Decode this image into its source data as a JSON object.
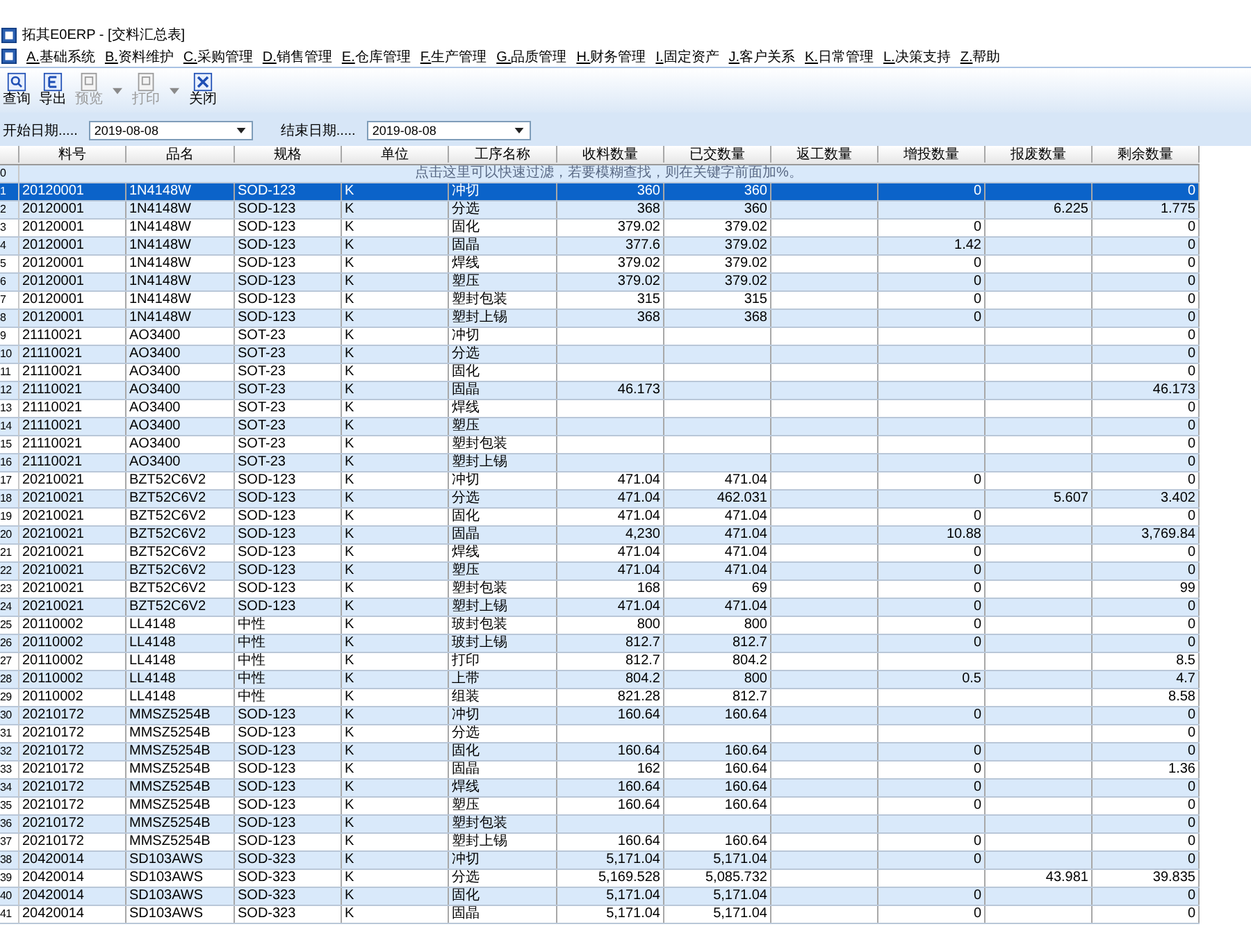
{
  "window": {
    "title": "拓其E0ERP - [交料汇总表]"
  },
  "menu": [
    "A.基础系统",
    "B.资料维护",
    "C.采购管理",
    "D.销售管理",
    "E.仓库管理",
    "F.生产管理",
    "G.品质管理",
    "H.财务管理",
    "I.固定资产",
    "J.客户关系",
    "K.日常管理",
    "L.决策支持",
    "Z.帮助"
  ],
  "toolbar": [
    {
      "kind": "query",
      "label": "查询",
      "disabled": false,
      "dropdown": false
    },
    {
      "kind": "export",
      "label": "导出",
      "disabled": false,
      "dropdown": false
    },
    {
      "kind": "preview",
      "label": "预览",
      "disabled": true,
      "dropdown": true
    },
    {
      "kind": "print",
      "label": "打印",
      "disabled": true,
      "dropdown": true
    },
    {
      "kind": "close",
      "label": "关闭",
      "disabled": false,
      "dropdown": false
    }
  ],
  "filters": [
    {
      "label": "开始日期.....",
      "value": "2019-08-08"
    },
    {
      "label": "结束日期.....",
      "value": "2019-08-08"
    }
  ],
  "table": {
    "columns": [
      "料号",
      "品名",
      "规格",
      "单位",
      "工序名称",
      "收料数量",
      "已交数量",
      "返工数量",
      "增投数量",
      "报废数量",
      "剩余数量"
    ],
    "filter_row": {
      "no": "0",
      "hint": "点击这里可以快速过滤，若要模糊查找，则在关键字前面加%。"
    },
    "rows": [
      {
        "no": "1",
        "selected": true,
        "cells": [
          "20120001",
          "1N4148W",
          "SOD-123",
          "K",
          "冲切",
          "360",
          "360",
          null,
          "0",
          null,
          "0"
        ]
      },
      {
        "no": "2",
        "selected": false,
        "cells": [
          "20120001",
          "1N4148W",
          "SOD-123",
          "K",
          "分选",
          "368",
          "360",
          null,
          null,
          "6.225",
          "1.775"
        ]
      },
      {
        "no": "3",
        "selected": false,
        "cells": [
          "20120001",
          "1N4148W",
          "SOD-123",
          "K",
          "固化",
          "379.02",
          "379.02",
          null,
          "0",
          null,
          "0"
        ]
      },
      {
        "no": "4",
        "selected": false,
        "cells": [
          "20120001",
          "1N4148W",
          "SOD-123",
          "K",
          "固晶",
          "377.6",
          "379.02",
          null,
          "1.42",
          null,
          "0"
        ]
      },
      {
        "no": "5",
        "selected": false,
        "cells": [
          "20120001",
          "1N4148W",
          "SOD-123",
          "K",
          "焊线",
          "379.02",
          "379.02",
          null,
          "0",
          null,
          "0"
        ]
      },
      {
        "no": "6",
        "selected": false,
        "cells": [
          "20120001",
          "1N4148W",
          "SOD-123",
          "K",
          "塑压",
          "379.02",
          "379.02",
          null,
          "0",
          null,
          "0"
        ]
      },
      {
        "no": "7",
        "selected": false,
        "cells": [
          "20120001",
          "1N4148W",
          "SOD-123",
          "K",
          "塑封包装",
          "315",
          "315",
          null,
          "0",
          null,
          "0"
        ]
      },
      {
        "no": "8",
        "selected": false,
        "cells": [
          "20120001",
          "1N4148W",
          "SOD-123",
          "K",
          "塑封上锡",
          "368",
          "368",
          null,
          "0",
          null,
          "0"
        ]
      },
      {
        "no": "9",
        "selected": false,
        "cells": [
          "21110021",
          "AO3400",
          "SOT-23",
          "K",
          "冲切",
          null,
          null,
          null,
          null,
          null,
          "0"
        ]
      },
      {
        "no": "10",
        "selected": false,
        "cells": [
          "21110021",
          "AO3400",
          "SOT-23",
          "K",
          "分选",
          null,
          null,
          null,
          null,
          null,
          "0"
        ]
      },
      {
        "no": "11",
        "selected": false,
        "cells": [
          "21110021",
          "AO3400",
          "SOT-23",
          "K",
          "固化",
          null,
          null,
          null,
          null,
          null,
          "0"
        ]
      },
      {
        "no": "12",
        "selected": false,
        "cells": [
          "21110021",
          "AO3400",
          "SOT-23",
          "K",
          "固晶",
          "46.173",
          null,
          null,
          null,
          null,
          "46.173"
        ]
      },
      {
        "no": "13",
        "selected": false,
        "cells": [
          "21110021",
          "AO3400",
          "SOT-23",
          "K",
          "焊线",
          null,
          null,
          null,
          null,
          null,
          "0"
        ]
      },
      {
        "no": "14",
        "selected": false,
        "cells": [
          "21110021",
          "AO3400",
          "SOT-23",
          "K",
          "塑压",
          null,
          null,
          null,
          null,
          null,
          "0"
        ]
      },
      {
        "no": "15",
        "selected": false,
        "cells": [
          "21110021",
          "AO3400",
          "SOT-23",
          "K",
          "塑封包装",
          null,
          null,
          null,
          null,
          null,
          "0"
        ]
      },
      {
        "no": "16",
        "selected": false,
        "cells": [
          "21110021",
          "AO3400",
          "SOT-23",
          "K",
          "塑封上锡",
          null,
          null,
          null,
          null,
          null,
          "0"
        ]
      },
      {
        "no": "17",
        "selected": false,
        "cells": [
          "20210021",
          "BZT52C6V2",
          "SOD-123",
          "K",
          "冲切",
          "471.04",
          "471.04",
          null,
          "0",
          null,
          "0"
        ]
      },
      {
        "no": "18",
        "selected": false,
        "cells": [
          "20210021",
          "BZT52C6V2",
          "SOD-123",
          "K",
          "分选",
          "471.04",
          "462.031",
          null,
          null,
          "5.607",
          "3.402"
        ]
      },
      {
        "no": "19",
        "selected": false,
        "cells": [
          "20210021",
          "BZT52C6V2",
          "SOD-123",
          "K",
          "固化",
          "471.04",
          "471.04",
          null,
          "0",
          null,
          "0"
        ]
      },
      {
        "no": "20",
        "selected": false,
        "cells": [
          "20210021",
          "BZT52C6V2",
          "SOD-123",
          "K",
          "固晶",
          "4,230",
          "471.04",
          null,
          "10.88",
          null,
          "3,769.84"
        ]
      },
      {
        "no": "21",
        "selected": false,
        "cells": [
          "20210021",
          "BZT52C6V2",
          "SOD-123",
          "K",
          "焊线",
          "471.04",
          "471.04",
          null,
          "0",
          null,
          "0"
        ]
      },
      {
        "no": "22",
        "selected": false,
        "cells": [
          "20210021",
          "BZT52C6V2",
          "SOD-123",
          "K",
          "塑压",
          "471.04",
          "471.04",
          null,
          "0",
          null,
          "0"
        ]
      },
      {
        "no": "23",
        "selected": false,
        "cells": [
          "20210021",
          "BZT52C6V2",
          "SOD-123",
          "K",
          "塑封包装",
          "168",
          "69",
          null,
          "0",
          null,
          "99"
        ]
      },
      {
        "no": "24",
        "selected": false,
        "cells": [
          "20210021",
          "BZT52C6V2",
          "SOD-123",
          "K",
          "塑封上锡",
          "471.04",
          "471.04",
          null,
          "0",
          null,
          "0"
        ]
      },
      {
        "no": "25",
        "selected": false,
        "cells": [
          "20110002",
          "LL4148",
          "中性",
          "K",
          "玻封包装",
          "800",
          "800",
          null,
          "0",
          null,
          "0"
        ]
      },
      {
        "no": "26",
        "selected": false,
        "cells": [
          "20110002",
          "LL4148",
          "中性",
          "K",
          "玻封上锡",
          "812.7",
          "812.7",
          null,
          "0",
          null,
          "0"
        ]
      },
      {
        "no": "27",
        "selected": false,
        "cells": [
          "20110002",
          "LL4148",
          "中性",
          "K",
          "打印",
          "812.7",
          "804.2",
          null,
          null,
          null,
          "8.5"
        ]
      },
      {
        "no": "28",
        "selected": false,
        "cells": [
          "20110002",
          "LL4148",
          "中性",
          "K",
          "上带",
          "804.2",
          "800",
          null,
          "0.5",
          null,
          "4.7"
        ]
      },
      {
        "no": "29",
        "selected": false,
        "cells": [
          "20110002",
          "LL4148",
          "中性",
          "K",
          "组装",
          "821.28",
          "812.7",
          null,
          null,
          null,
          "8.58"
        ]
      },
      {
        "no": "30",
        "selected": false,
        "cells": [
          "20210172",
          "MMSZ5254B",
          "SOD-123",
          "K",
          "冲切",
          "160.64",
          "160.64",
          null,
          "0",
          null,
          "0"
        ]
      },
      {
        "no": "31",
        "selected": false,
        "cells": [
          "20210172",
          "MMSZ5254B",
          "SOD-123",
          "K",
          "分选",
          null,
          null,
          null,
          null,
          null,
          "0"
        ]
      },
      {
        "no": "32",
        "selected": false,
        "cells": [
          "20210172",
          "MMSZ5254B",
          "SOD-123",
          "K",
          "固化",
          "160.64",
          "160.64",
          null,
          "0",
          null,
          "0"
        ]
      },
      {
        "no": "33",
        "selected": false,
        "cells": [
          "20210172",
          "MMSZ5254B",
          "SOD-123",
          "K",
          "固晶",
          "162",
          "160.64",
          null,
          "0",
          null,
          "1.36"
        ]
      },
      {
        "no": "34",
        "selected": false,
        "cells": [
          "20210172",
          "MMSZ5254B",
          "SOD-123",
          "K",
          "焊线",
          "160.64",
          "160.64",
          null,
          "0",
          null,
          "0"
        ]
      },
      {
        "no": "35",
        "selected": false,
        "cells": [
          "20210172",
          "MMSZ5254B",
          "SOD-123",
          "K",
          "塑压",
          "160.64",
          "160.64",
          null,
          "0",
          null,
          "0"
        ]
      },
      {
        "no": "36",
        "selected": false,
        "cells": [
          "20210172",
          "MMSZ5254B",
          "SOD-123",
          "K",
          "塑封包装",
          null,
          null,
          null,
          null,
          null,
          "0"
        ]
      },
      {
        "no": "37",
        "selected": false,
        "cells": [
          "20210172",
          "MMSZ5254B",
          "SOD-123",
          "K",
          "塑封上锡",
          "160.64",
          "160.64",
          null,
          "0",
          null,
          "0"
        ]
      },
      {
        "no": "38",
        "selected": false,
        "cells": [
          "20420014",
          "SD103AWS",
          "SOD-323",
          "K",
          "冲切",
          "5,171.04",
          "5,171.04",
          null,
          "0",
          null,
          "0"
        ]
      },
      {
        "no": "39",
        "selected": false,
        "cells": [
          "20420014",
          "SD103AWS",
          "SOD-323",
          "K",
          "分选",
          "5,169.528",
          "5,085.732",
          null,
          null,
          "43.981",
          "39.835"
        ]
      },
      {
        "no": "40",
        "selected": false,
        "cells": [
          "20420014",
          "SD103AWS",
          "SOD-323",
          "K",
          "固化",
          "5,171.04",
          "5,171.04",
          null,
          "0",
          null,
          "0"
        ]
      },
      {
        "no": "41",
        "selected": false,
        "cells": [
          "20420014",
          "SD103AWS",
          "SOD-323",
          "K",
          "固晶",
          "5,171.04",
          "5,171.04",
          null,
          "0",
          null,
          "0"
        ]
      }
    ]
  }
}
